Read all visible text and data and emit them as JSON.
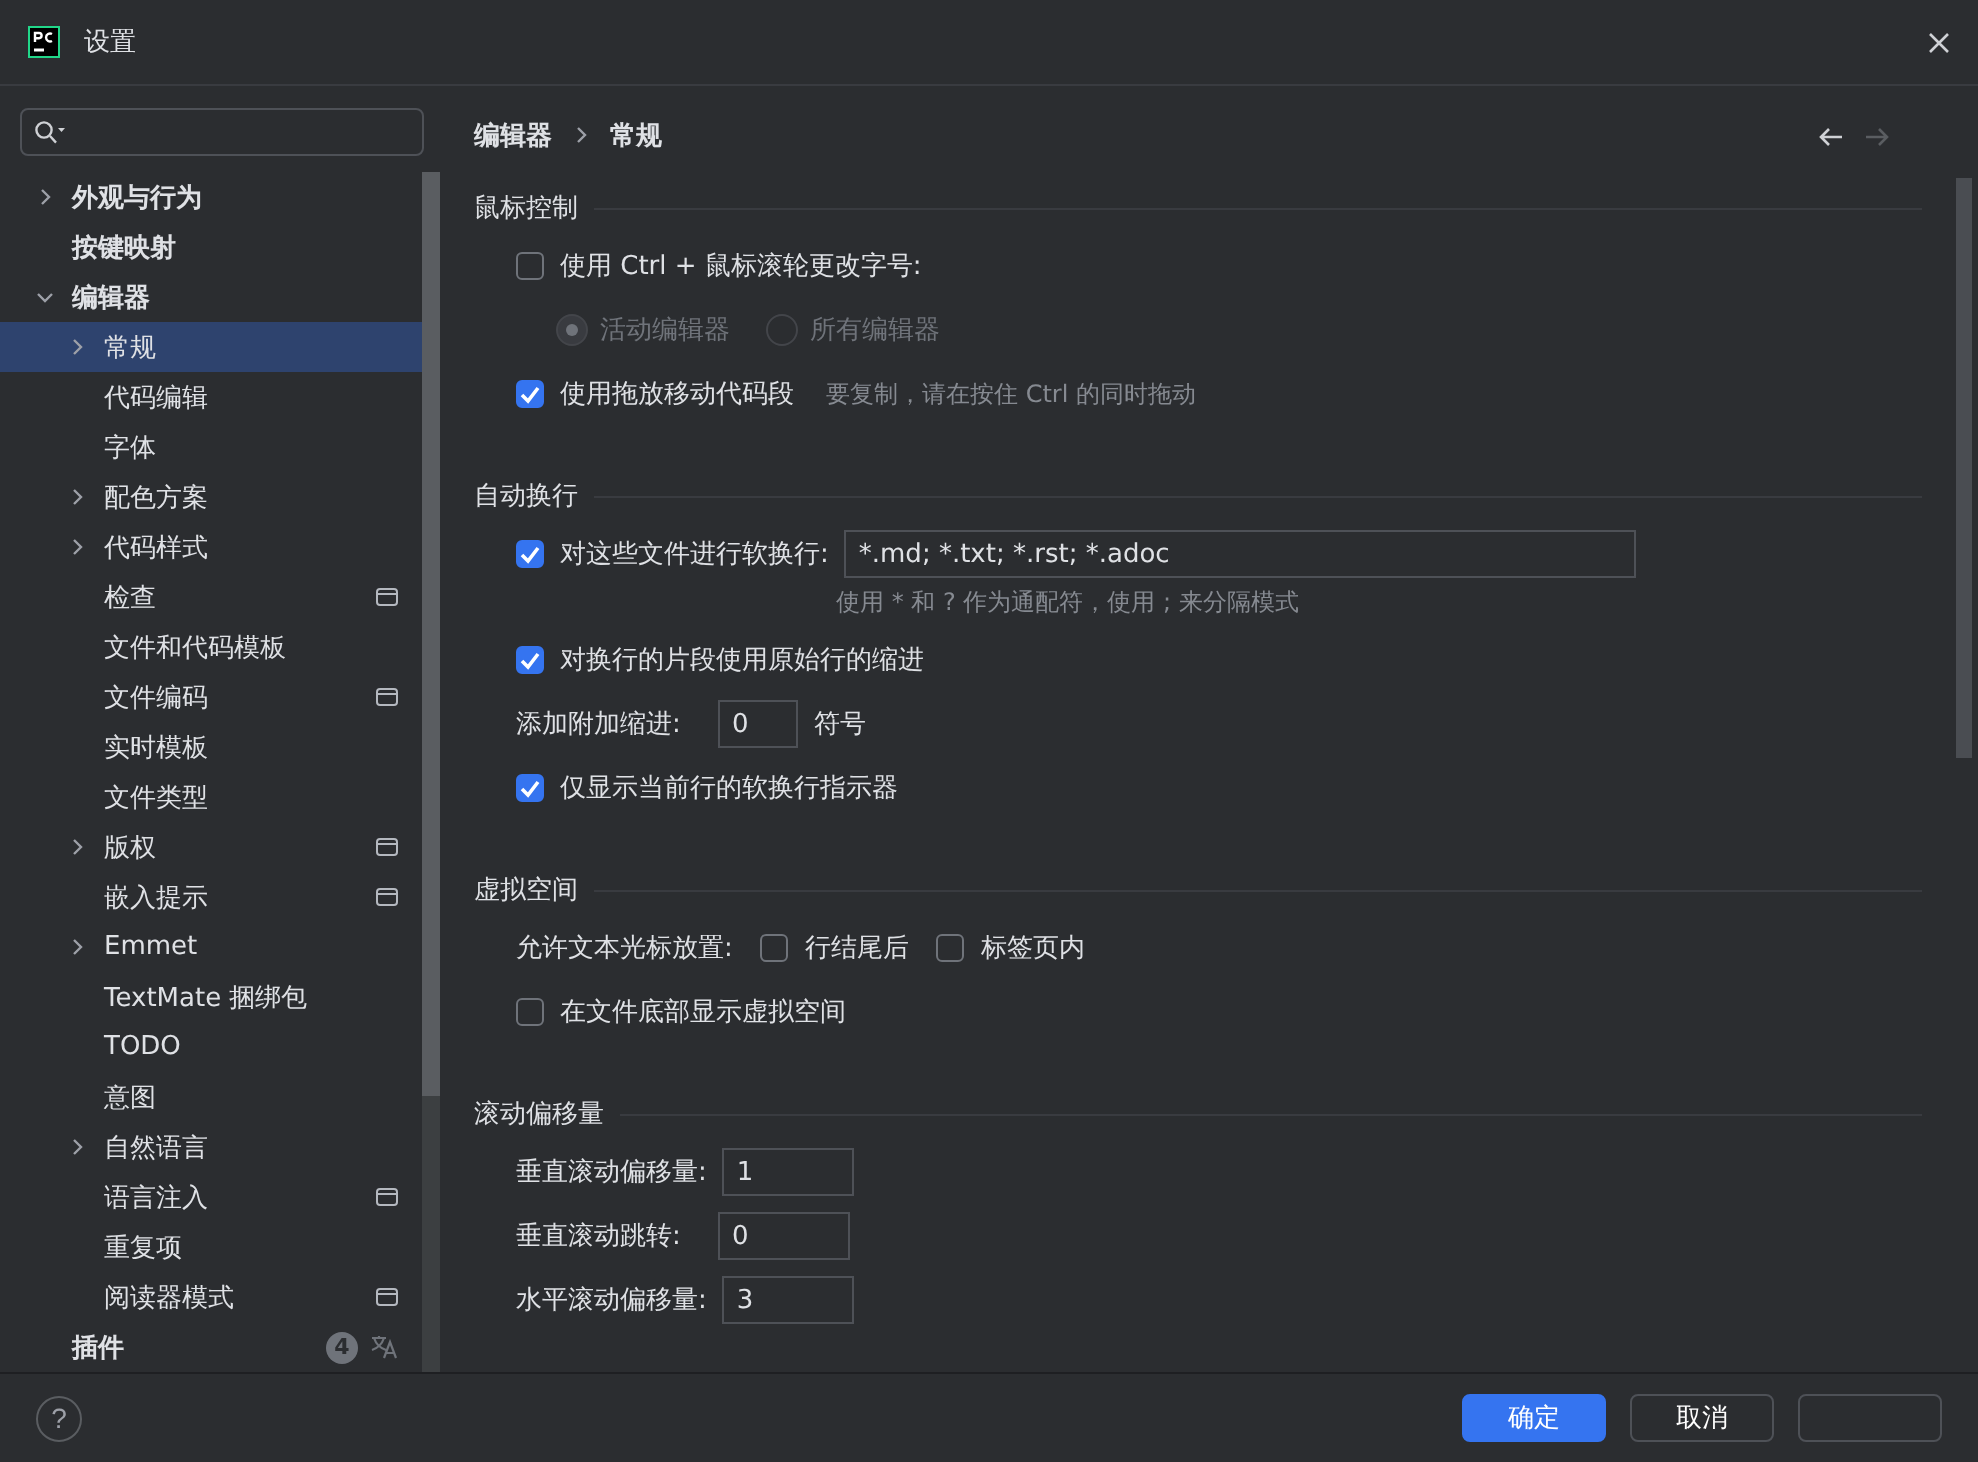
{
  "window": {
    "title": "设置"
  },
  "sidebar": {
    "items": [
      {
        "label": "外观与行为",
        "kind": "group",
        "expanded": false,
        "selected": false,
        "project_scope": false
      },
      {
        "label": "按键映射",
        "kind": "page",
        "selected": false,
        "project_scope": false
      },
      {
        "label": "编辑器",
        "kind": "group",
        "expanded": true,
        "selected": false,
        "project_scope": false,
        "children": [
          {
            "label": "常规",
            "kind": "group",
            "expanded": false,
            "selected": true,
            "project_scope": false
          },
          {
            "label": "代码编辑",
            "kind": "page",
            "selected": false,
            "project_scope": false
          },
          {
            "label": "字体",
            "kind": "page",
            "selected": false,
            "project_scope": false
          },
          {
            "label": "配色方案",
            "kind": "group",
            "expanded": false,
            "selected": false,
            "project_scope": false
          },
          {
            "label": "代码样式",
            "kind": "group",
            "expanded": false,
            "selected": false,
            "project_scope": false
          },
          {
            "label": "检查",
            "kind": "page",
            "selected": false,
            "project_scope": true
          },
          {
            "label": "文件和代码模板",
            "kind": "page",
            "selected": false,
            "project_scope": false
          },
          {
            "label": "文件编码",
            "kind": "page",
            "selected": false,
            "project_scope": true
          },
          {
            "label": "实时模板",
            "kind": "page",
            "selected": false,
            "project_scope": false
          },
          {
            "label": "文件类型",
            "kind": "page",
            "selected": false,
            "project_scope": false
          },
          {
            "label": "版权",
            "kind": "group",
            "expanded": false,
            "selected": false,
            "project_scope": true
          },
          {
            "label": "嵌入提示",
            "kind": "page",
            "selected": false,
            "project_scope": true
          },
          {
            "label": "Emmet",
            "kind": "group",
            "expanded": false,
            "selected": false,
            "project_scope": false
          },
          {
            "label": "TextMate 捆绑包",
            "kind": "page",
            "selected": false,
            "project_scope": false
          },
          {
            "label": "TODO",
            "kind": "page",
            "selected": false,
            "project_scope": false
          },
          {
            "label": "意图",
            "kind": "page",
            "selected": false,
            "project_scope": false
          },
          {
            "label": "自然语言",
            "kind": "group",
            "expanded": false,
            "selected": false,
            "project_scope": false
          },
          {
            "label": "语言注入",
            "kind": "page",
            "selected": false,
            "project_scope": true
          },
          {
            "label": "重复项",
            "kind": "page",
            "selected": false,
            "project_scope": false
          },
          {
            "label": "阅读器模式",
            "kind": "page",
            "selected": false,
            "project_scope": true
          }
        ]
      },
      {
        "label": "插件",
        "kind": "page",
        "selected": false,
        "project_scope": false,
        "badge": "4"
      }
    ]
  },
  "breadcrumb": [
    "编辑器",
    "常规"
  ],
  "sections": [
    {
      "title": "鼠标控制",
      "rows": [
        {
          "kind": "checkbox",
          "label": "使用 Ctrl + 鼠标滚轮更改字号:",
          "checked": false
        },
        {
          "kind": "radios",
          "options": [
            {
              "label": "活动编辑器",
              "selected": true,
              "disabled": true
            },
            {
              "label": "所有编辑器",
              "selected": false,
              "disabled": true
            }
          ]
        },
        {
          "kind": "checkbox",
          "label": "使用拖放移动代码段",
          "checked": true,
          "hint": "要复制，请在按住 Ctrl 的同时拖动"
        }
      ]
    },
    {
      "title": "自动换行",
      "rows": [
        {
          "kind": "checkbox_field",
          "label": "对这些文件进行软换行:",
          "checked": true,
          "value": "*.md; *.txt; *.rst; *.adoc",
          "hint": "使用 * 和 ? 作为通配符，使用 ; 来分隔模式"
        },
        {
          "kind": "checkbox",
          "label": "对换行的片段使用原始行的缩进",
          "checked": true
        },
        {
          "kind": "number",
          "label": "添加附加缩进:",
          "value": "0",
          "unit": "符号"
        },
        {
          "kind": "checkbox",
          "label": "仅显示当前行的软换行指示器",
          "checked": true
        }
      ]
    },
    {
      "title": "虚拟空间",
      "rows": [
        {
          "kind": "inline_checks",
          "label": "允许文本光标放置:",
          "options": [
            {
              "label": "行结尾后",
              "checked": false
            },
            {
              "label": "标签页内",
              "checked": false
            }
          ]
        },
        {
          "kind": "checkbox",
          "label": "在文件底部显示虚拟空间",
          "checked": false
        }
      ]
    },
    {
      "title": "滚动偏移量",
      "rows": [
        {
          "kind": "number",
          "label": "垂直滚动偏移量:",
          "value": "1"
        },
        {
          "kind": "number",
          "label": "垂直滚动跳转:",
          "value": "0"
        },
        {
          "kind": "number",
          "label": "水平滚动偏移量:",
          "value": "3"
        }
      ]
    }
  ],
  "help": "?",
  "buttons": [
    {
      "label": "确定",
      "primary": true
    },
    {
      "label": "取消",
      "primary": false
    },
    {
      "primary": false
    }
  ]
}
